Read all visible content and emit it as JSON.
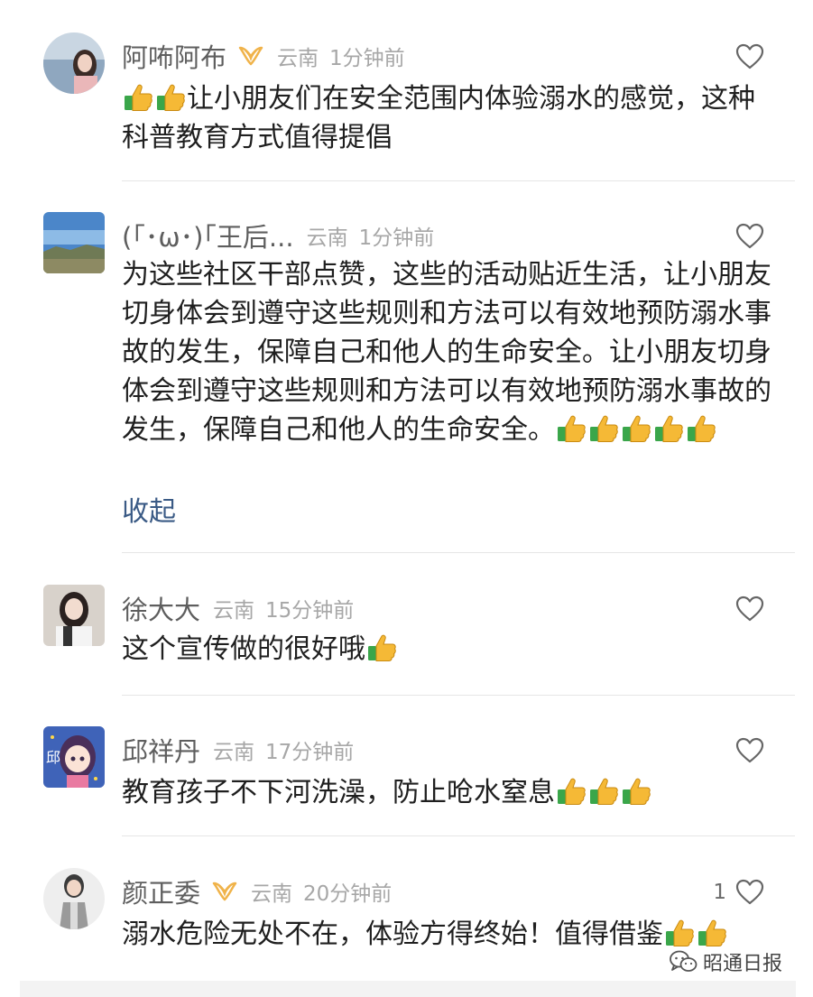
{
  "comments": [
    {
      "name": "阿咘阿布",
      "vip": true,
      "location": "云南",
      "time": "1分钟前",
      "like_count": "",
      "text": "让小朋友们在安全范围内体验溺水的感觉，这种科普教育方式值得提倡",
      "thumbs_before": 2,
      "thumbs_after": 0
    },
    {
      "name": "(｢･ω･)｢王后...",
      "vip": false,
      "location": "云南",
      "time": "1分钟前",
      "like_count": "",
      "text": "为这些社区干部点赞，这些的活动贴近生活，让小朋友切身体会到遵守这些规则和方法可以有效地预防溺水事故的发生，保障自己和他人的生命安全。让小朋友切身体会到遵守这些规则和方法可以有效地预防溺水事故的发生，保障自己和他人的生命安全。",
      "thumbs_before": 0,
      "thumbs_after": 5,
      "collapse_label": "收起"
    },
    {
      "name": "徐大大",
      "vip": false,
      "location": "云南",
      "time": "15分钟前",
      "like_count": "",
      "text": "这个宣传做的很好哦",
      "thumbs_before": 0,
      "thumbs_after": 1
    },
    {
      "name": "邱祥丹",
      "vip": false,
      "location": "云南",
      "time": "17分钟前",
      "like_count": "",
      "text": "教育孩子不下河洗澡，防止呛水窒息",
      "thumbs_before": 0,
      "thumbs_after": 3,
      "avatar_char": "邱"
    },
    {
      "name": "颜正委",
      "vip": true,
      "location": "云南",
      "time": "20分钟前",
      "like_count": "1",
      "text": "溺水危险无处不在，体验方得终始！值得借鉴",
      "thumbs_before": 0,
      "thumbs_after": 2
    }
  ],
  "watermark": {
    "text": "昭通日报",
    "icon": "wechat-icon"
  },
  "icons": {
    "like": "heart-outline-icon",
    "vip": "vip-badge-icon",
    "emoji": "thumbs-up-emoji-icon"
  },
  "colors": {
    "name": "#5e5e5e",
    "meta": "#a7a7a7",
    "text": "#1f1f1f",
    "link": "#3a5a85",
    "vip": "#f0b34a",
    "thumb": "#f5b936",
    "cuff": "#3aa64a"
  }
}
